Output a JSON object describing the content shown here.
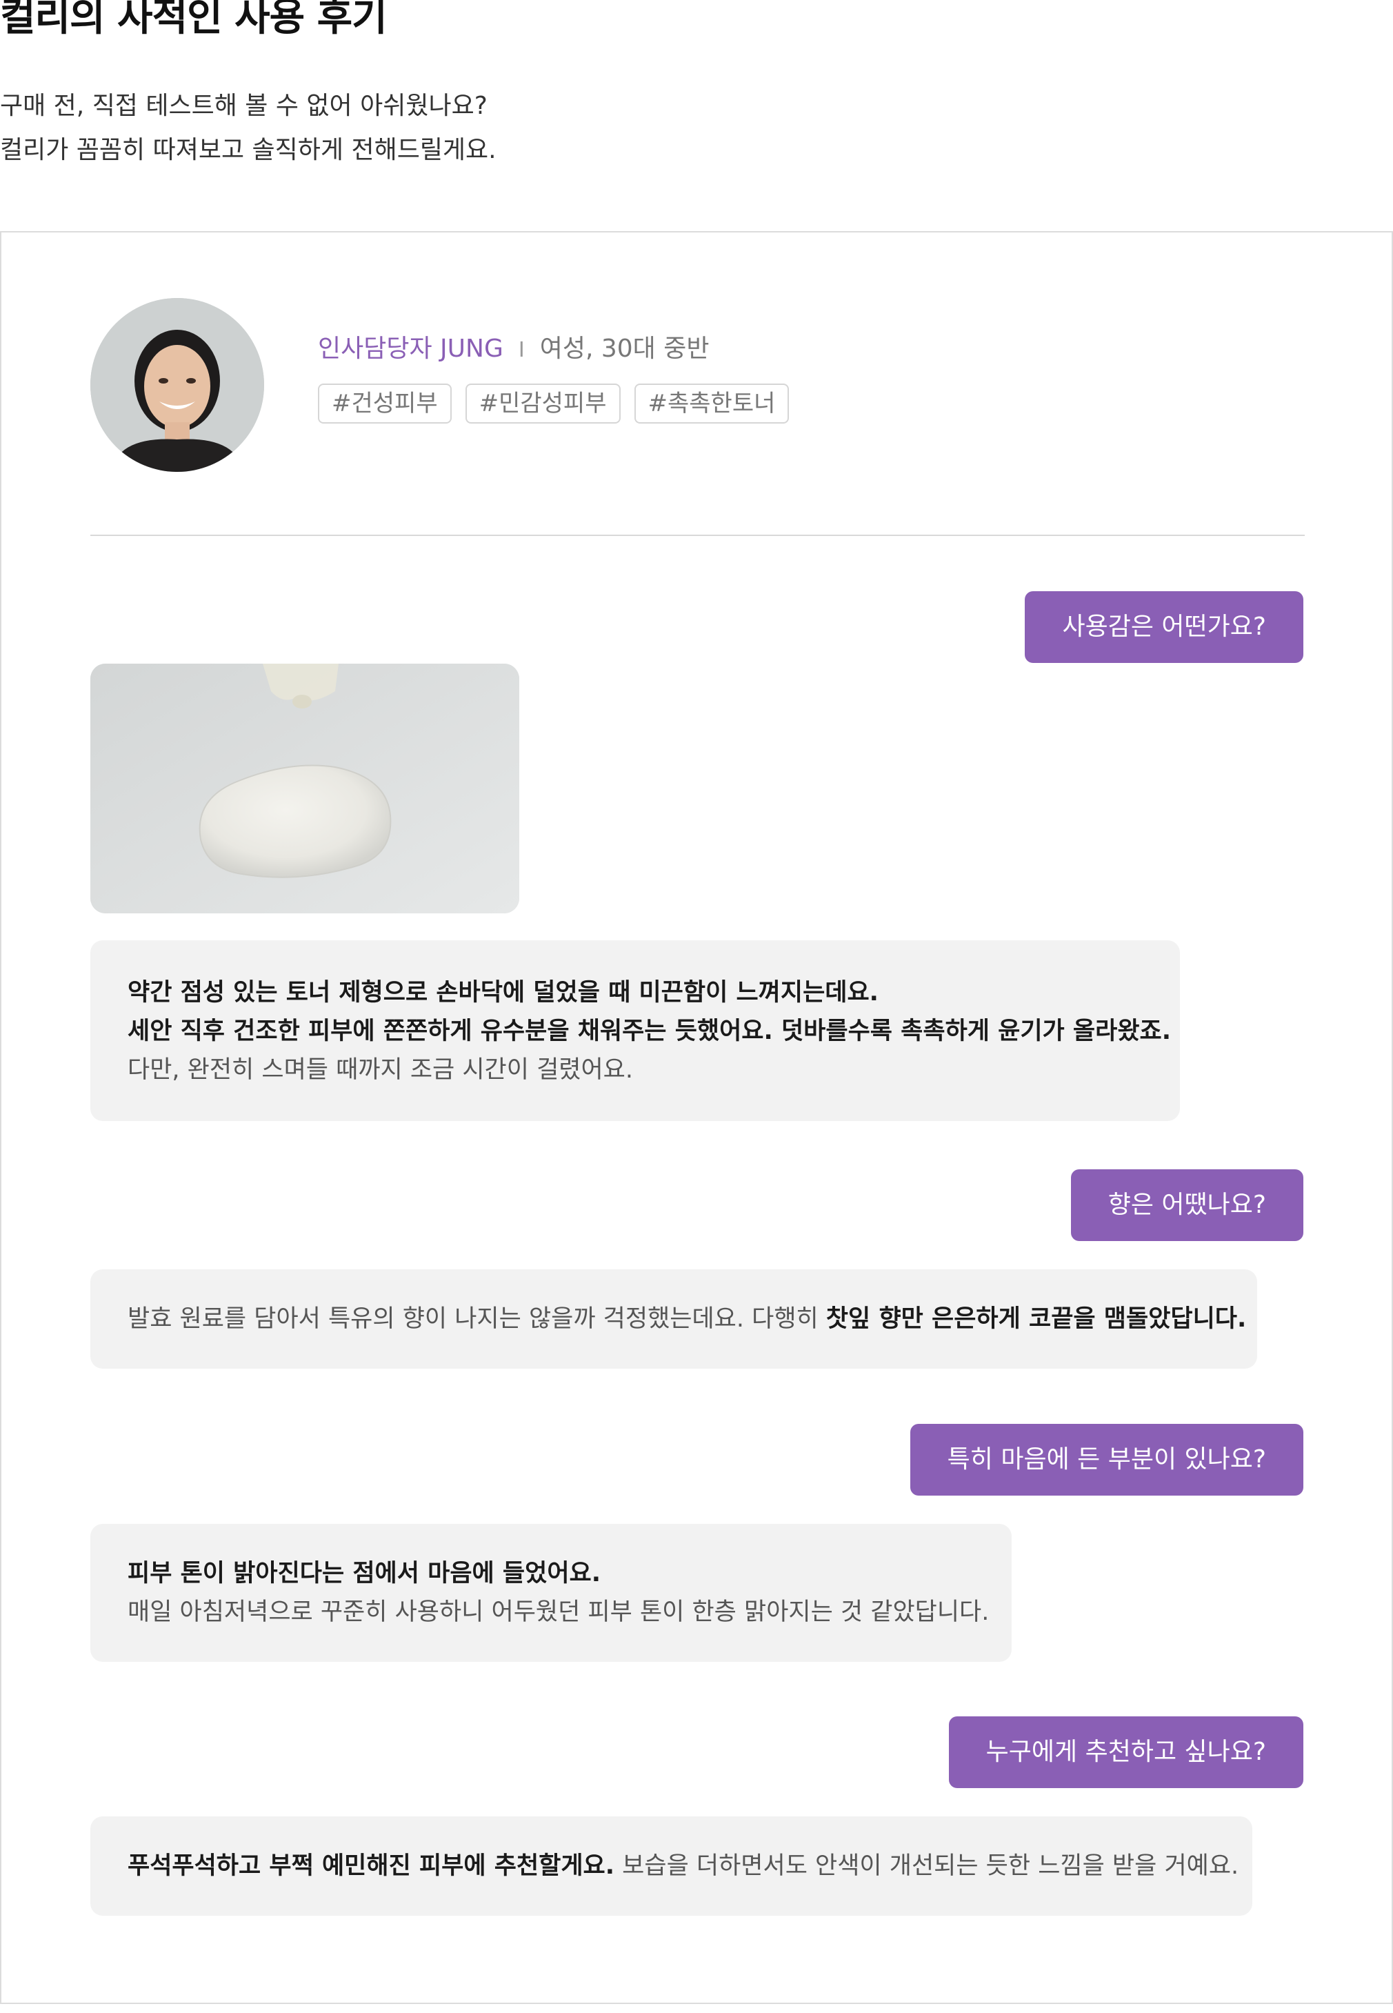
{
  "header": {
    "title": "컬리의 사적인 사용 후기",
    "intro_line1": "구매 전, 직접 테스트해 볼 수 없어 아쉬웠나요?",
    "intro_line2": "컬리가 꼼꼼히 따져보고 솔직하게 전해드릴게요."
  },
  "reviewer": {
    "name": "인사담당자 JUNG",
    "separator": "I",
    "meta": "여성, 30대 중반",
    "tags": [
      "#건성피부",
      "#민감성피부",
      "#촉촉한토너"
    ]
  },
  "qa": [
    {
      "question": "사용감은 어떤가요?",
      "answer_bold_line1": "약간 점성 있는 토너 제형으로 손바닥에 덜었을 때 미끈함이 느껴지는데요.",
      "answer_bold_line2": "세안 직후 건조한 피부에 쫀쫀하게 유수분을 채워주는 듯했어요. 덧바를수록 촉촉하게 윤기가 올라왔죠.",
      "answer_normal": "다만, 완전히 스며들 때까지 조금 시간이 걸렸어요."
    },
    {
      "question": "향은 어땠나요?",
      "answer_normal": "발효 원료를 담아서 특유의 향이 나지는 않을까 걱정했는데요. 다행히 ",
      "answer_bold": "찻잎 향만 은은하게 코끝을 맴돌았답니다."
    },
    {
      "question": "특히 마음에 든 부분이 있나요?",
      "answer_bold": "피부 톤이 밝아진다는 점에서 마음에 들었어요.",
      "answer_normal": "매일 아침저녁으로 꾸준히 사용하니 어두웠던 피부 톤이 한층 맑아지는 것 같았답니다."
    },
    {
      "question": "누구에게 추천하고 싶나요?",
      "answer_bold": "푸석푸석하고 부쩍 예민해진 피부에 추천할게요.",
      "answer_normal": " 보습을 더하면서도 안색이 개선되는 듯한 느낌을 받을 거예요."
    }
  ],
  "colors": {
    "accent": "#8a5fb5",
    "bubble_bg": "#f2f2f2",
    "border": "#dcdcdc"
  }
}
